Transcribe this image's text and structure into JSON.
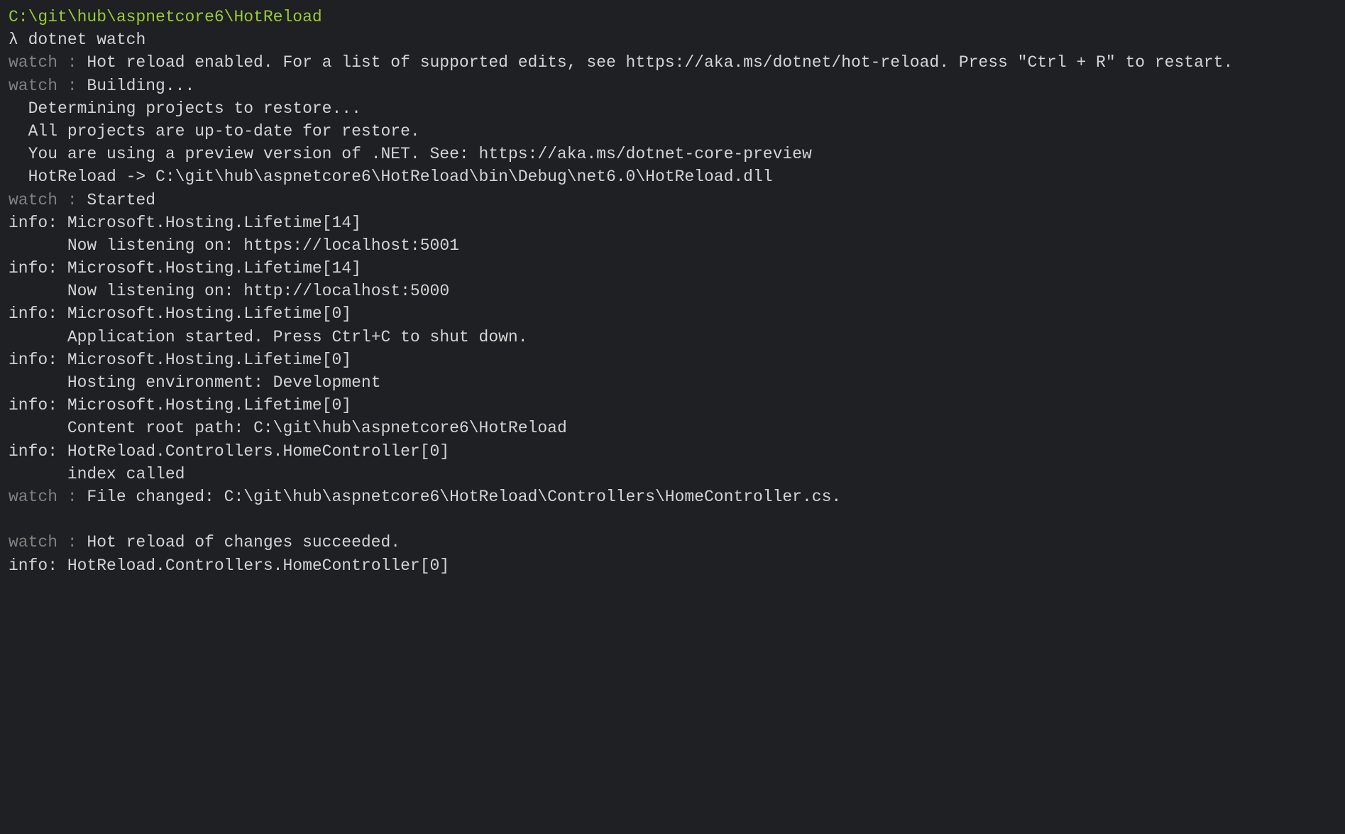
{
  "terminal": {
    "path": "C:\\git\\hub\\aspnetcore6\\HotReload",
    "prompt": "λ",
    "command": "dotnet watch",
    "lines": [
      {
        "prefix": "watch : ",
        "text": "Hot reload enabled. For a list of supported edits, see https://aka.ms/dotnet/hot-reload. Press \"Ctrl + R\" to restart.",
        "type": "watch"
      },
      {
        "prefix": "watch : ",
        "text": "Building...",
        "type": "watch"
      },
      {
        "prefix": "",
        "text": "Determining projects to restore...",
        "type": "indent"
      },
      {
        "prefix": "",
        "text": "All projects are up-to-date for restore.",
        "type": "indent"
      },
      {
        "prefix": "",
        "text": "You are using a preview version of .NET. See: https://aka.ms/dotnet-core-preview",
        "type": "indent"
      },
      {
        "prefix": "",
        "text": "HotReload -> C:\\git\\hub\\aspnetcore6\\HotReload\\bin\\Debug\\net6.0\\HotReload.dll",
        "type": "indent"
      },
      {
        "prefix": "watch : ",
        "text": "Started",
        "type": "watch"
      },
      {
        "prefix": "info: ",
        "text": "Microsoft.Hosting.Lifetime[14]",
        "type": "info"
      },
      {
        "prefix": "",
        "text": "Now listening on: https://localhost:5001",
        "type": "indent-deep"
      },
      {
        "prefix": "info: ",
        "text": "Microsoft.Hosting.Lifetime[14]",
        "type": "info"
      },
      {
        "prefix": "",
        "text": "Now listening on: http://localhost:5000",
        "type": "indent-deep"
      },
      {
        "prefix": "info: ",
        "text": "Microsoft.Hosting.Lifetime[0]",
        "type": "info"
      },
      {
        "prefix": "",
        "text": "Application started. Press Ctrl+C to shut down.",
        "type": "indent-deep"
      },
      {
        "prefix": "info: ",
        "text": "Microsoft.Hosting.Lifetime[0]",
        "type": "info"
      },
      {
        "prefix": "",
        "text": "Hosting environment: Development",
        "type": "indent-deep"
      },
      {
        "prefix": "info: ",
        "text": "Microsoft.Hosting.Lifetime[0]",
        "type": "info"
      },
      {
        "prefix": "",
        "text": "Content root path: C:\\git\\hub\\aspnetcore6\\HotReload",
        "type": "indent-deep"
      },
      {
        "prefix": "info: ",
        "text": "HotReload.Controllers.HomeController[0]",
        "type": "info"
      },
      {
        "prefix": "",
        "text": "index called",
        "type": "indent-deep"
      },
      {
        "prefix": "watch : ",
        "text": "File changed: C:\\git\\hub\\aspnetcore6\\HotReload\\Controllers\\HomeController.cs.",
        "type": "watch"
      },
      {
        "prefix": "",
        "text": "",
        "type": "blank"
      },
      {
        "prefix": "watch : ",
        "text": "Hot reload of changes succeeded.",
        "type": "watch"
      },
      {
        "prefix": "info: ",
        "text": "HotReload.Controllers.HomeController[0]",
        "type": "info"
      }
    ]
  }
}
